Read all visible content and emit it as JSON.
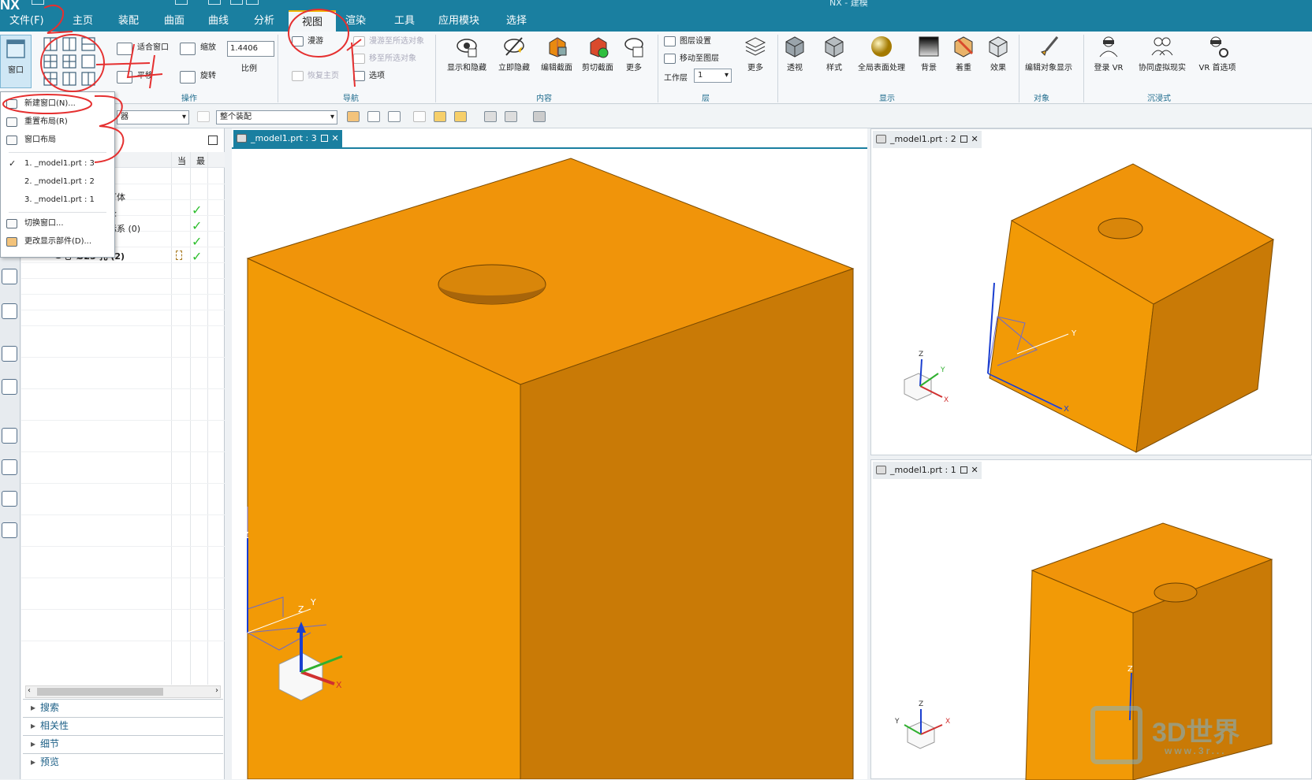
{
  "app": {
    "logo": "NX",
    "window_title": "NX - 建模"
  },
  "menubar": {
    "items": [
      "文件(F)",
      "主页",
      "装配",
      "曲面",
      "曲线",
      "分析",
      "视图",
      "渲染",
      "工具",
      "应用模块",
      "选择"
    ],
    "active": "视图"
  },
  "ribbon": {
    "window_btn": "窗口",
    "fit_window": "适合窗口",
    "zoom": "缩放",
    "zoom_value": "1.4406",
    "scale_label": "比例",
    "pan": "平移",
    "rotate": "旋转",
    "group_operation": "操作",
    "roam": "漫游",
    "roam_to_selected": "漫游至所选对象",
    "move_to_selected": "移至所选对象",
    "restore_home": "恢复主页",
    "options": "选项",
    "group_navigation": "导航",
    "show_hide": "显示和隐藏",
    "immediate_hide": "立即隐藏",
    "edit_section": "编辑截面",
    "clip_section": "剪切截面",
    "more1": "更多",
    "group_content": "内容",
    "layer_settings": "图层设置",
    "move_to_layer": "移动至图层",
    "work_layer_label": "工作层",
    "work_layer_value": "1",
    "more2": "更多",
    "group_layer": "层",
    "perspective": "透视",
    "style": "样式",
    "global_surface": "全局表面处理",
    "background": "背景",
    "coloring": "着重",
    "effects": "效果",
    "group_display": "显示",
    "edit_object_display": "编辑对象显示",
    "group_object": "对象",
    "login_vr": "登录 VR",
    "collab_vr": "协同虚拟现实",
    "vr_prefs": "VR 首选项",
    "group_immersive": "沉浸式"
  },
  "toolbar2": {
    "filter_value": "器",
    "assembly_value": "整个装配"
  },
  "nav": {
    "col_current": "当",
    "col_latest": "最",
    "rows": [
      "可体",
      "录",
      "标系 (0)",
      "",
      "Ø25 孔 (2)"
    ],
    "sections": [
      "搜索",
      "相关性",
      "细节",
      "预览"
    ]
  },
  "window_menu": {
    "new_window": "新建窗口(N)...",
    "reset_layout": "重置布局(R)",
    "window_layout": "窗口布局",
    "windows": [
      "1. _model1.prt : 3",
      "2. _model1.prt : 2",
      "3. _model1.prt : 1"
    ],
    "switch_window": "切换窗口...",
    "change_display_part": "更改显示部件(D)..."
  },
  "viewports": {
    "main_tab": "_model1.prt : 3",
    "tr_tab": "_model1.prt : 2",
    "br_tab": "_model1.prt : 1"
  },
  "axes": {
    "x": "X",
    "y": "Y",
    "z": "Z"
  },
  "annotations": [
    "1",
    "2",
    "3",
    "4"
  ],
  "watermark": {
    "brand": "3D世界",
    "url": "www.3r..."
  },
  "colors": {
    "accent": "#1a7fa0",
    "cube_top": "#f0940a",
    "cube_left": "#f29a06",
    "cube_right": "#c97a06",
    "annotation": "#e53030"
  }
}
